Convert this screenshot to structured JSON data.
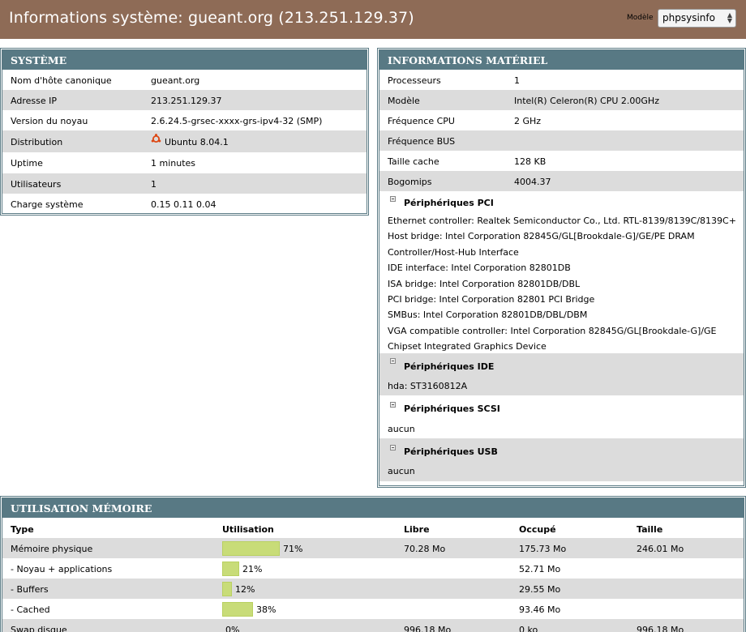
{
  "header": {
    "title": "Informations système: gueant.org (213.251.129.37)",
    "template_label": "Modèle",
    "template_value": "phpsysinfo",
    "bg_color": "#8e6b56"
  },
  "systeme": {
    "title": "SYSTÈME",
    "rows": [
      {
        "key": "Nom d'hôte canonique",
        "value": "gueant.org"
      },
      {
        "key": "Adresse IP",
        "value": "213.251.129.37"
      },
      {
        "key": "Version du noyau",
        "value": "2.6.24.5-grsec-xxxx-grs-ipv4-32 (SMP)"
      },
      {
        "key": "Distribution",
        "value": "Ubuntu 8.04.1",
        "icon": "ubuntu-logo-icon"
      },
      {
        "key": "Uptime",
        "value": "1 minutes"
      },
      {
        "key": "Utilisateurs",
        "value": "1"
      },
      {
        "key": "Charge système",
        "value": "0.15 0.11 0.04"
      }
    ]
  },
  "materiel": {
    "title": "INFORMATIONS MATÉRIEL",
    "rows": [
      {
        "key": "Processeurs",
        "value": "1"
      },
      {
        "key": "Modèle",
        "value": "Intel(R) Celeron(R) CPU 2.00GHz"
      },
      {
        "key": "Fréquence CPU",
        "value": "2 GHz"
      },
      {
        "key": "Fréquence BUS",
        "value": ""
      },
      {
        "key": "Taille cache",
        "value": "128 KB"
      },
      {
        "key": "Bogomips",
        "value": "4004.37"
      }
    ],
    "pci": {
      "title": "Périphériques PCI",
      "items": [
        "Ethernet controller: Realtek Semiconductor Co., Ltd. RTL-8139/8139C/8139C+",
        "Host bridge: Intel Corporation 82845G/GL[Brookdale-G]/GE/PE DRAM",
        "Controller/Host-Hub Interface",
        "IDE interface: Intel Corporation 82801DB",
        "ISA bridge: Intel Corporation 82801DB/DBL",
        "PCI bridge: Intel Corporation 82801 PCI Bridge",
        "SMBus: Intel Corporation 82801DB/DBL/DBM",
        "VGA compatible controller: Intel Corporation 82845G/GL[Brookdale-G]/GE",
        "Chipset Integrated Graphics Device"
      ]
    },
    "ide": {
      "title": "Périphériques IDE",
      "value": "hda: ST3160812A"
    },
    "scsi": {
      "title": "Périphériques SCSI",
      "value": "aucun"
    },
    "usb": {
      "title": "Périphériques USB",
      "value": "aucun"
    }
  },
  "memoire": {
    "title": "UTILISATION MÉMOIRE",
    "columns": [
      "Type",
      "Utilisation",
      "Libre",
      "Occupé",
      "Taille"
    ],
    "rows": [
      {
        "type": "Mémoire physique",
        "percent": 71,
        "percent_label": "71%",
        "libre": "70.28 Mo",
        "occupe": "175.73 Mo",
        "taille": "246.01 Mo"
      },
      {
        "type": "- Noyau + applications",
        "percent": 21,
        "percent_label": "21%",
        "libre": "",
        "occupe": "52.71 Mo",
        "taille": ""
      },
      {
        "type": "- Buffers",
        "percent": 12,
        "percent_label": "12%",
        "libre": "",
        "occupe": "29.55 Mo",
        "taille": ""
      },
      {
        "type": "- Cached",
        "percent": 38,
        "percent_label": "38%",
        "libre": "",
        "occupe": "93.46 Mo",
        "taille": ""
      },
      {
        "type": "Swap disque",
        "percent": 0,
        "percent_label": "0%",
        "libre": "996.18 Mo",
        "occupe": "0 ko",
        "taille": "996.18 Mo"
      }
    ]
  },
  "colors": {
    "panel_header": "#587984",
    "bar": "#c8dc78",
    "alt_row": "#dcdcdc"
  }
}
